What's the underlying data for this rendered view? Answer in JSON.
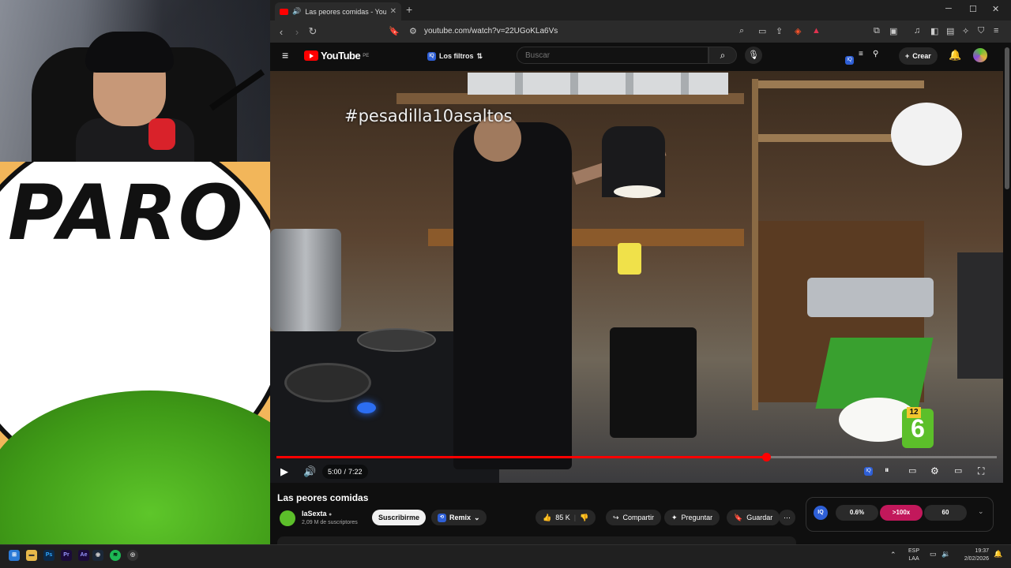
{
  "browser": {
    "tab_title": "Las peores comidas - YouTube",
    "new_tab_symbol": "+",
    "url": "youtube.com/watch?v=22UGoKLa6Vs"
  },
  "youtube_header": {
    "logo_text": "YouTube",
    "region": "PE",
    "filters_label": "Los filtros",
    "search_placeholder": "Buscar",
    "create_label": "Crear"
  },
  "player": {
    "hashtag": "#pesadilla10asaltos",
    "current_time": "5:00",
    "separator": "/",
    "duration": "7:22",
    "progress_fraction": 0.68,
    "rating_badge": "12",
    "channel_bug": "6"
  },
  "video": {
    "title": "Las peores comidas",
    "channel_name": "laSexta",
    "subscribers": "2,09 M de suscriptores",
    "subscribe_label": "Suscribirme",
    "remix_label": "Remix",
    "likes": "85 K",
    "share_label": "Compartir",
    "ask_label": "Preguntar",
    "save_label": "Guardar"
  },
  "iq_panel": {
    "stat_1": "0.6%",
    "stat_2": ">100x",
    "stat_3": "60"
  },
  "overlay": {
    "meme_text": "PARO"
  },
  "taskbar": {
    "language_line1": "ESP",
    "language_line2": "LAA",
    "time": "19:37",
    "date": "2/02/2026"
  },
  "colors": {
    "youtube_red": "#ff0000",
    "progress_red": "#ff0000",
    "lasexta_green": "#5cbf2a",
    "iq_pink": "#c2185b",
    "iq_blue": "#2e5fd6"
  }
}
